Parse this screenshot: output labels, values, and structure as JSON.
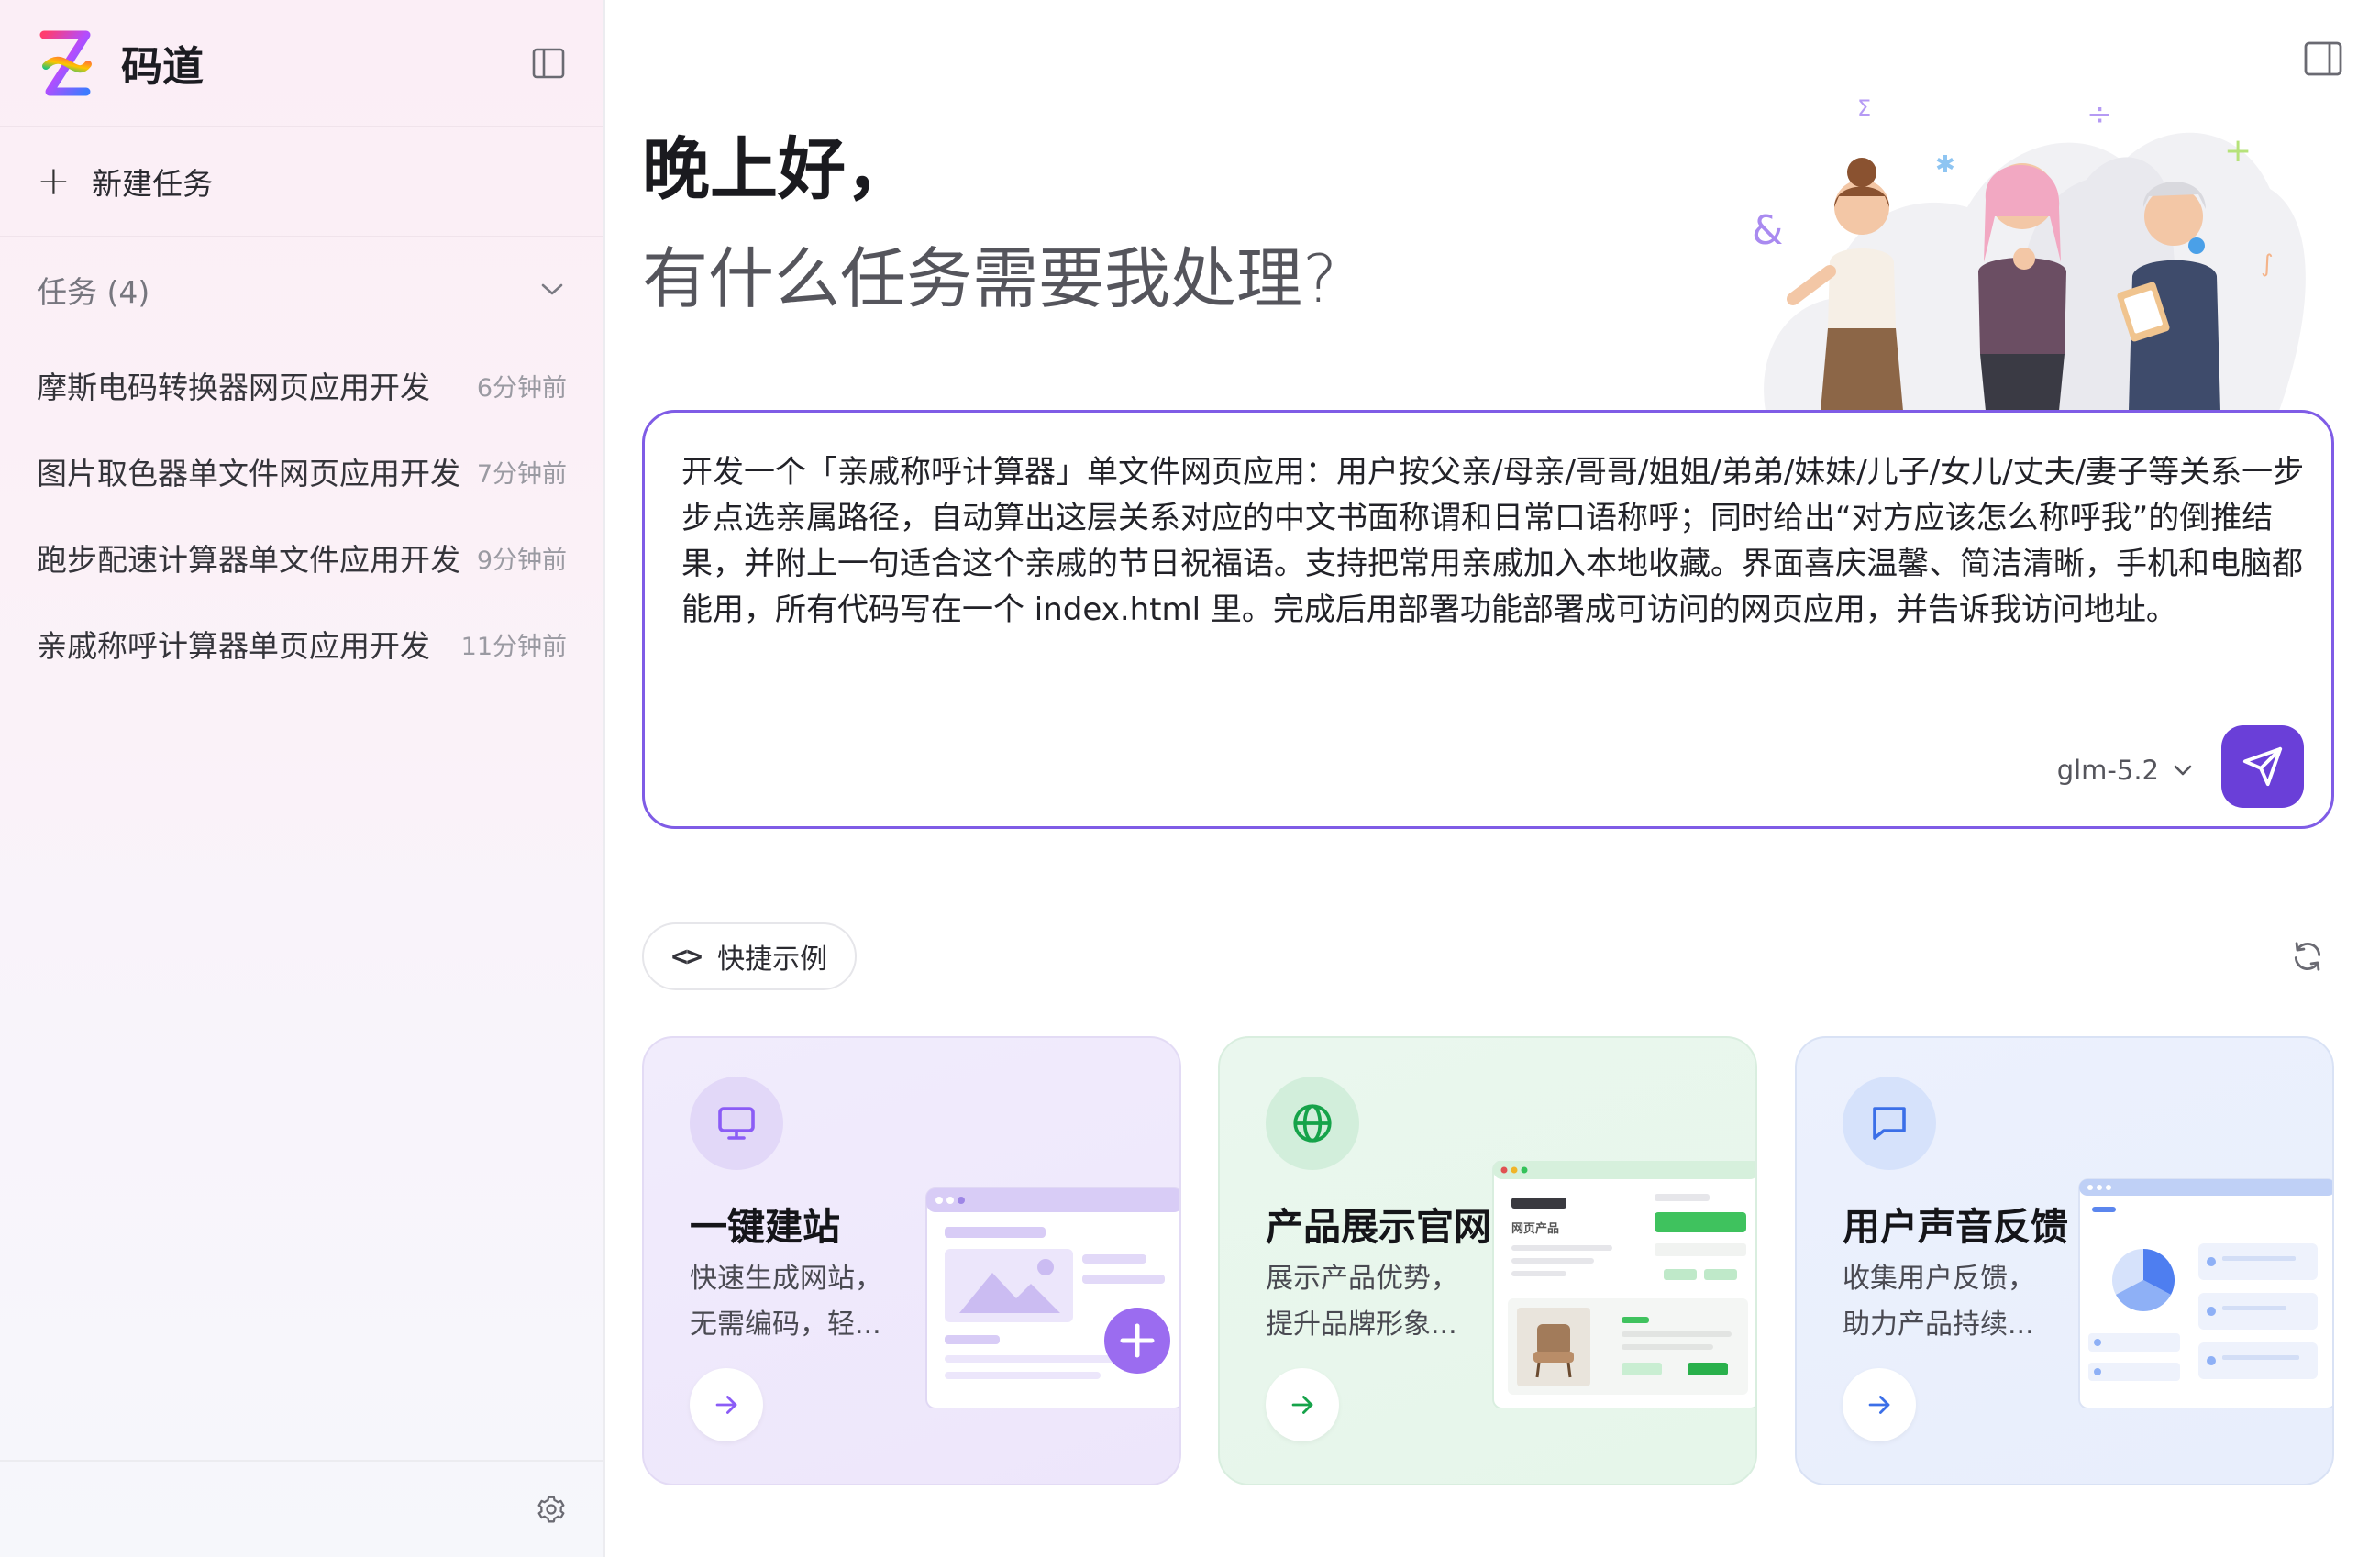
{
  "sidebar": {
    "brand": "码道",
    "new_task_label": "新建任务",
    "tasks_header": "任务 (4)",
    "tasks": [
      {
        "name": "摩斯电码转换器网页应用开发",
        "time": "6分钟前"
      },
      {
        "name": "图片取色器单文件网页应用开发",
        "time": "7分钟前"
      },
      {
        "name": "跑步配速计算器单文件应用开发",
        "time": "9分钟前"
      },
      {
        "name": "亲戚称呼计算器单页应用开发",
        "time": "11分钟前"
      }
    ]
  },
  "main": {
    "greeting": "晚上好，",
    "subtitle": "有什么任务需要我处理?",
    "prompt": {
      "text": "开发一个「亲戚称呼计算器」单文件网页应用：用户按父亲/母亲/哥哥/姐姐/弟弟/妹妹/儿子/女儿/丈夫/妻子等关系一步步点选亲属路径，自动算出这层关系对应的中文书面称谓和日常口语称呼；同时给出“对方应该怎么称呼我”的倒推结果，并附上一句适合这个亲戚的节日祝福语。支持把常用亲戚加入本地收藏。界面喜庆温馨、简洁清晰，手机和电脑都能用，所有代码写在一个 index.html 里。完成后用部署功能部署成可访问的网页应用，并告诉我访问地址。",
      "model": "glm-5.2"
    },
    "quick_examples_label": "快捷示例",
    "mock_label": "网页产品",
    "cards": [
      {
        "title": "一键建站",
        "desc": "快速生成网站，无需编码，轻...",
        "icon": "monitor-icon"
      },
      {
        "title": "产品展示官网",
        "desc": "展示产品优势，提升品牌形象...",
        "icon": "globe-icon"
      },
      {
        "title": "用户声音反馈",
        "desc": "收集用户反馈，助力产品持续...",
        "icon": "chat-bubble-icon"
      }
    ]
  },
  "colors": {
    "accent": "#6a3fd8",
    "prompt_border": "#7f5ce6",
    "card1_bg": "#efe9fc",
    "card2_bg": "#e8f6ec",
    "card3_bg": "#eaf0fd"
  }
}
